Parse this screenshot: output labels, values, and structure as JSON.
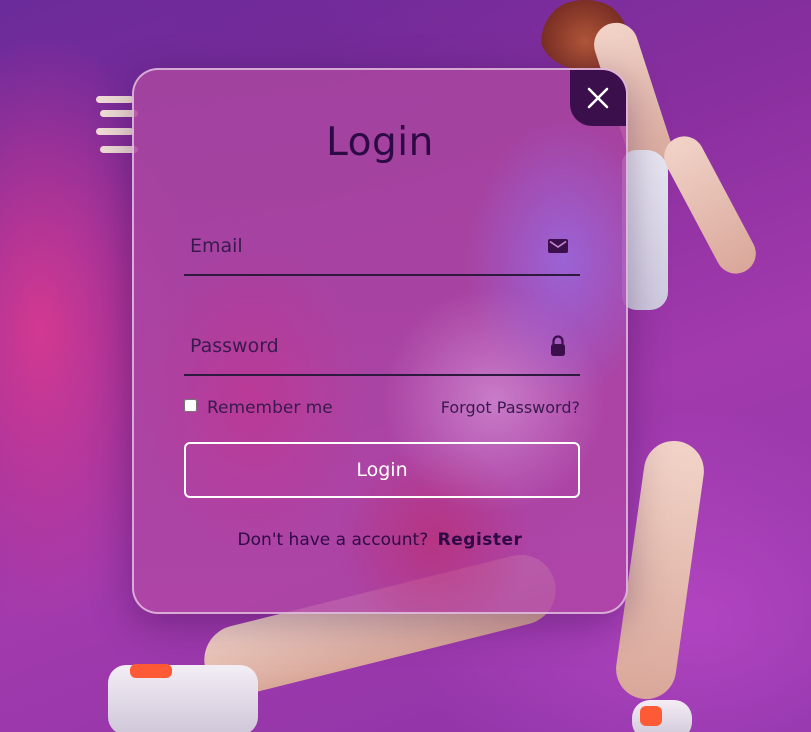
{
  "login_form": {
    "title": "Login",
    "email": {
      "placeholder": "Email",
      "value": "",
      "icon": "mail-icon"
    },
    "password": {
      "placeholder": "Password",
      "value": "",
      "icon": "lock-icon"
    },
    "remember_label": "Remember me",
    "remember_checked": false,
    "forgot_label": "Forgot Password?",
    "submit_label": "Login",
    "register_prompt": "Don't have a account?",
    "register_link": "Register",
    "close_icon": "close-icon"
  },
  "colors": {
    "background": "#8a2f9f",
    "text_dark": "#2e0a45",
    "close_button": "#3a0f4c",
    "button_border": "#ffffff",
    "field_underline": "#2e1a3e"
  }
}
